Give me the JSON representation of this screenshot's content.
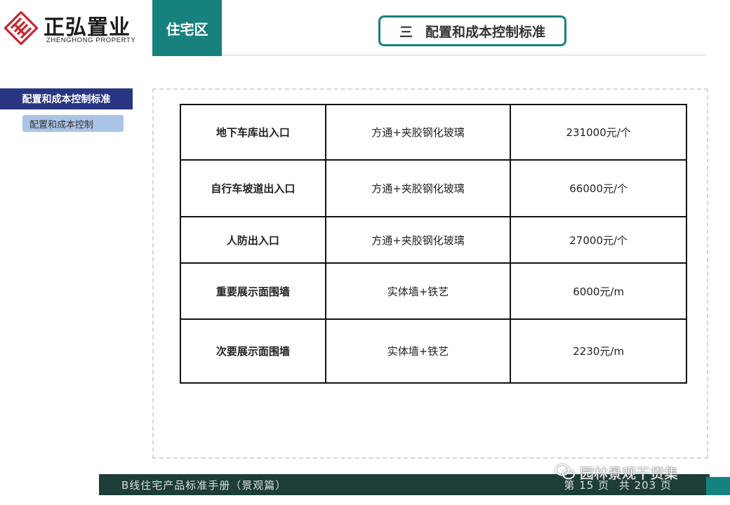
{
  "brand": {
    "name_cn": "正弘置业",
    "name_en": "ZHENGHONG PROPERTY"
  },
  "header": {
    "district_tab": "住宅区",
    "section_number": "三",
    "section_title": "配置和成本控制标准"
  },
  "sidebar": {
    "primary": "配置和成本控制标准",
    "secondary": "配置和成本控制"
  },
  "table": {
    "rows": [
      [
        "地下车库出入口",
        "方通+夹胶钢化玻璃",
        "231000元/个"
      ],
      [
        "自行车坡道出入口",
        "方通+夹胶钢化玻璃",
        "66000元/个"
      ],
      [
        "人防出入口",
        "方通+夹胶钢化玻璃",
        "27000元/个"
      ],
      [
        "重要展示面围墙",
        "实体墙+铁艺",
        "6000元/m"
      ],
      [
        "次要展示面围墙",
        "实体墙+铁艺",
        "2230元/m"
      ]
    ]
  },
  "footer": {
    "manual_title": "B线住宅产品标准手册（景观篇）",
    "page_label": "第 15 页",
    "total_label": "共 203 页"
  },
  "watermark": {
    "text": "园林景观干货集"
  },
  "colors": {
    "teal": "#17817e",
    "navy": "#283582",
    "light_blue": "#a9c4e6",
    "footer_dark": "#1c3d38",
    "logo_red": "#c8262f"
  },
  "icons": {
    "logo": "diamond-lattice-logo-icon",
    "watermark": "wechat-icon"
  }
}
